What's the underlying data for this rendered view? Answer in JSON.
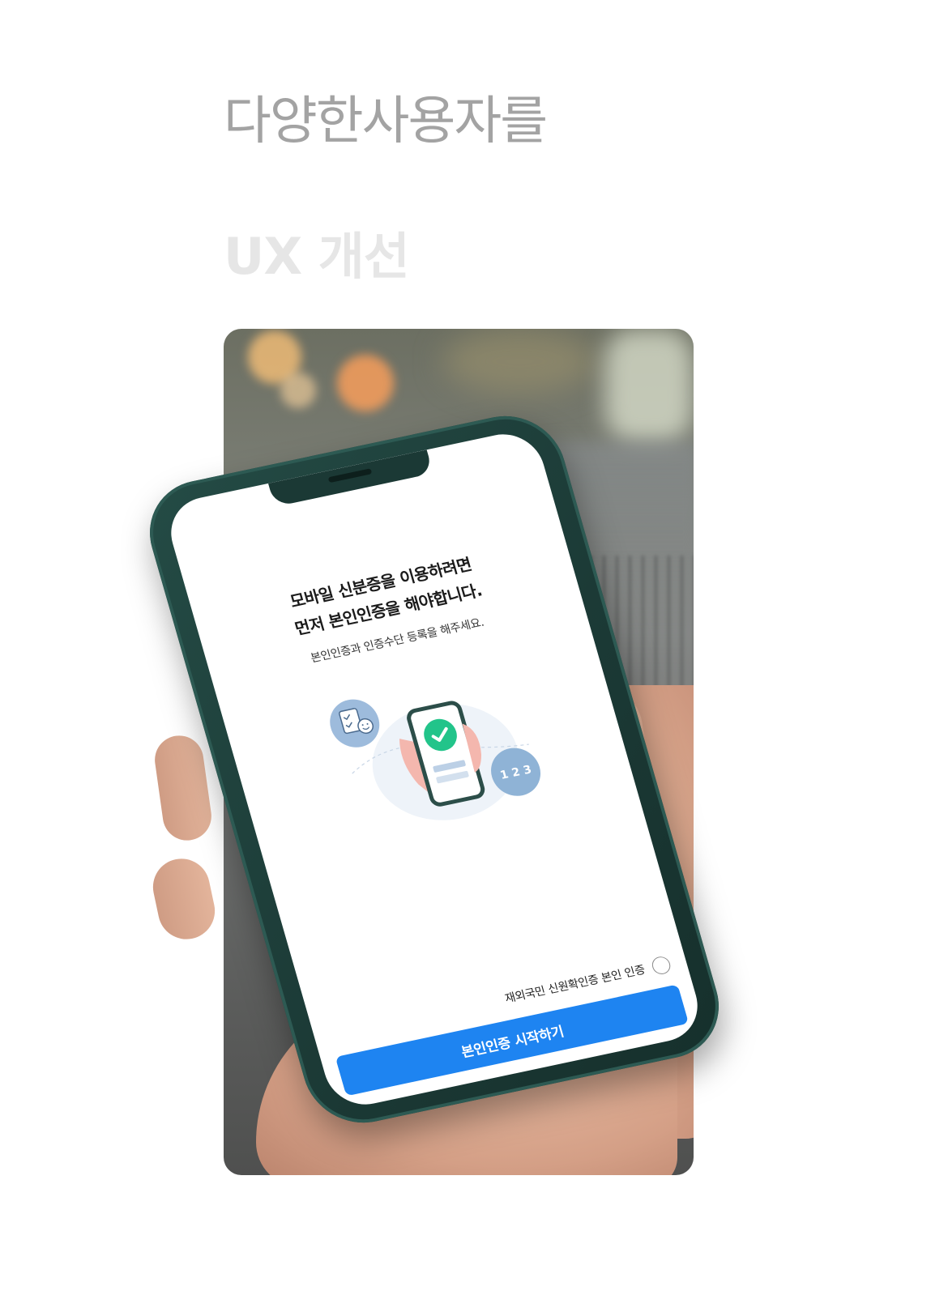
{
  "headline": {
    "line1": "다양한사용자를",
    "line2": "UX 개선"
  },
  "phone_screen": {
    "title": "모바일 신분증을 이용하려면\n먼저 본인인증을 해야합니다.",
    "subtitle": "본인인증과 인증수단 등록을 해주세요.",
    "illustration": {
      "left_bubble_icon": "checklist-face-icon",
      "right_bubble_text": "1 2 3",
      "center_icon": "check-icon"
    },
    "option_label": "재외국민 신원확인증 본인 인증",
    "cta_label": "본인인증 시작하기"
  },
  "colors": {
    "headline1": "#a3a3a3",
    "headline2": "#e6e6e6",
    "phone_case": "#1b3935",
    "cta": "#1e84f1",
    "check_green": "#22c48a",
    "bubble_blue": "#8fb3d6"
  }
}
